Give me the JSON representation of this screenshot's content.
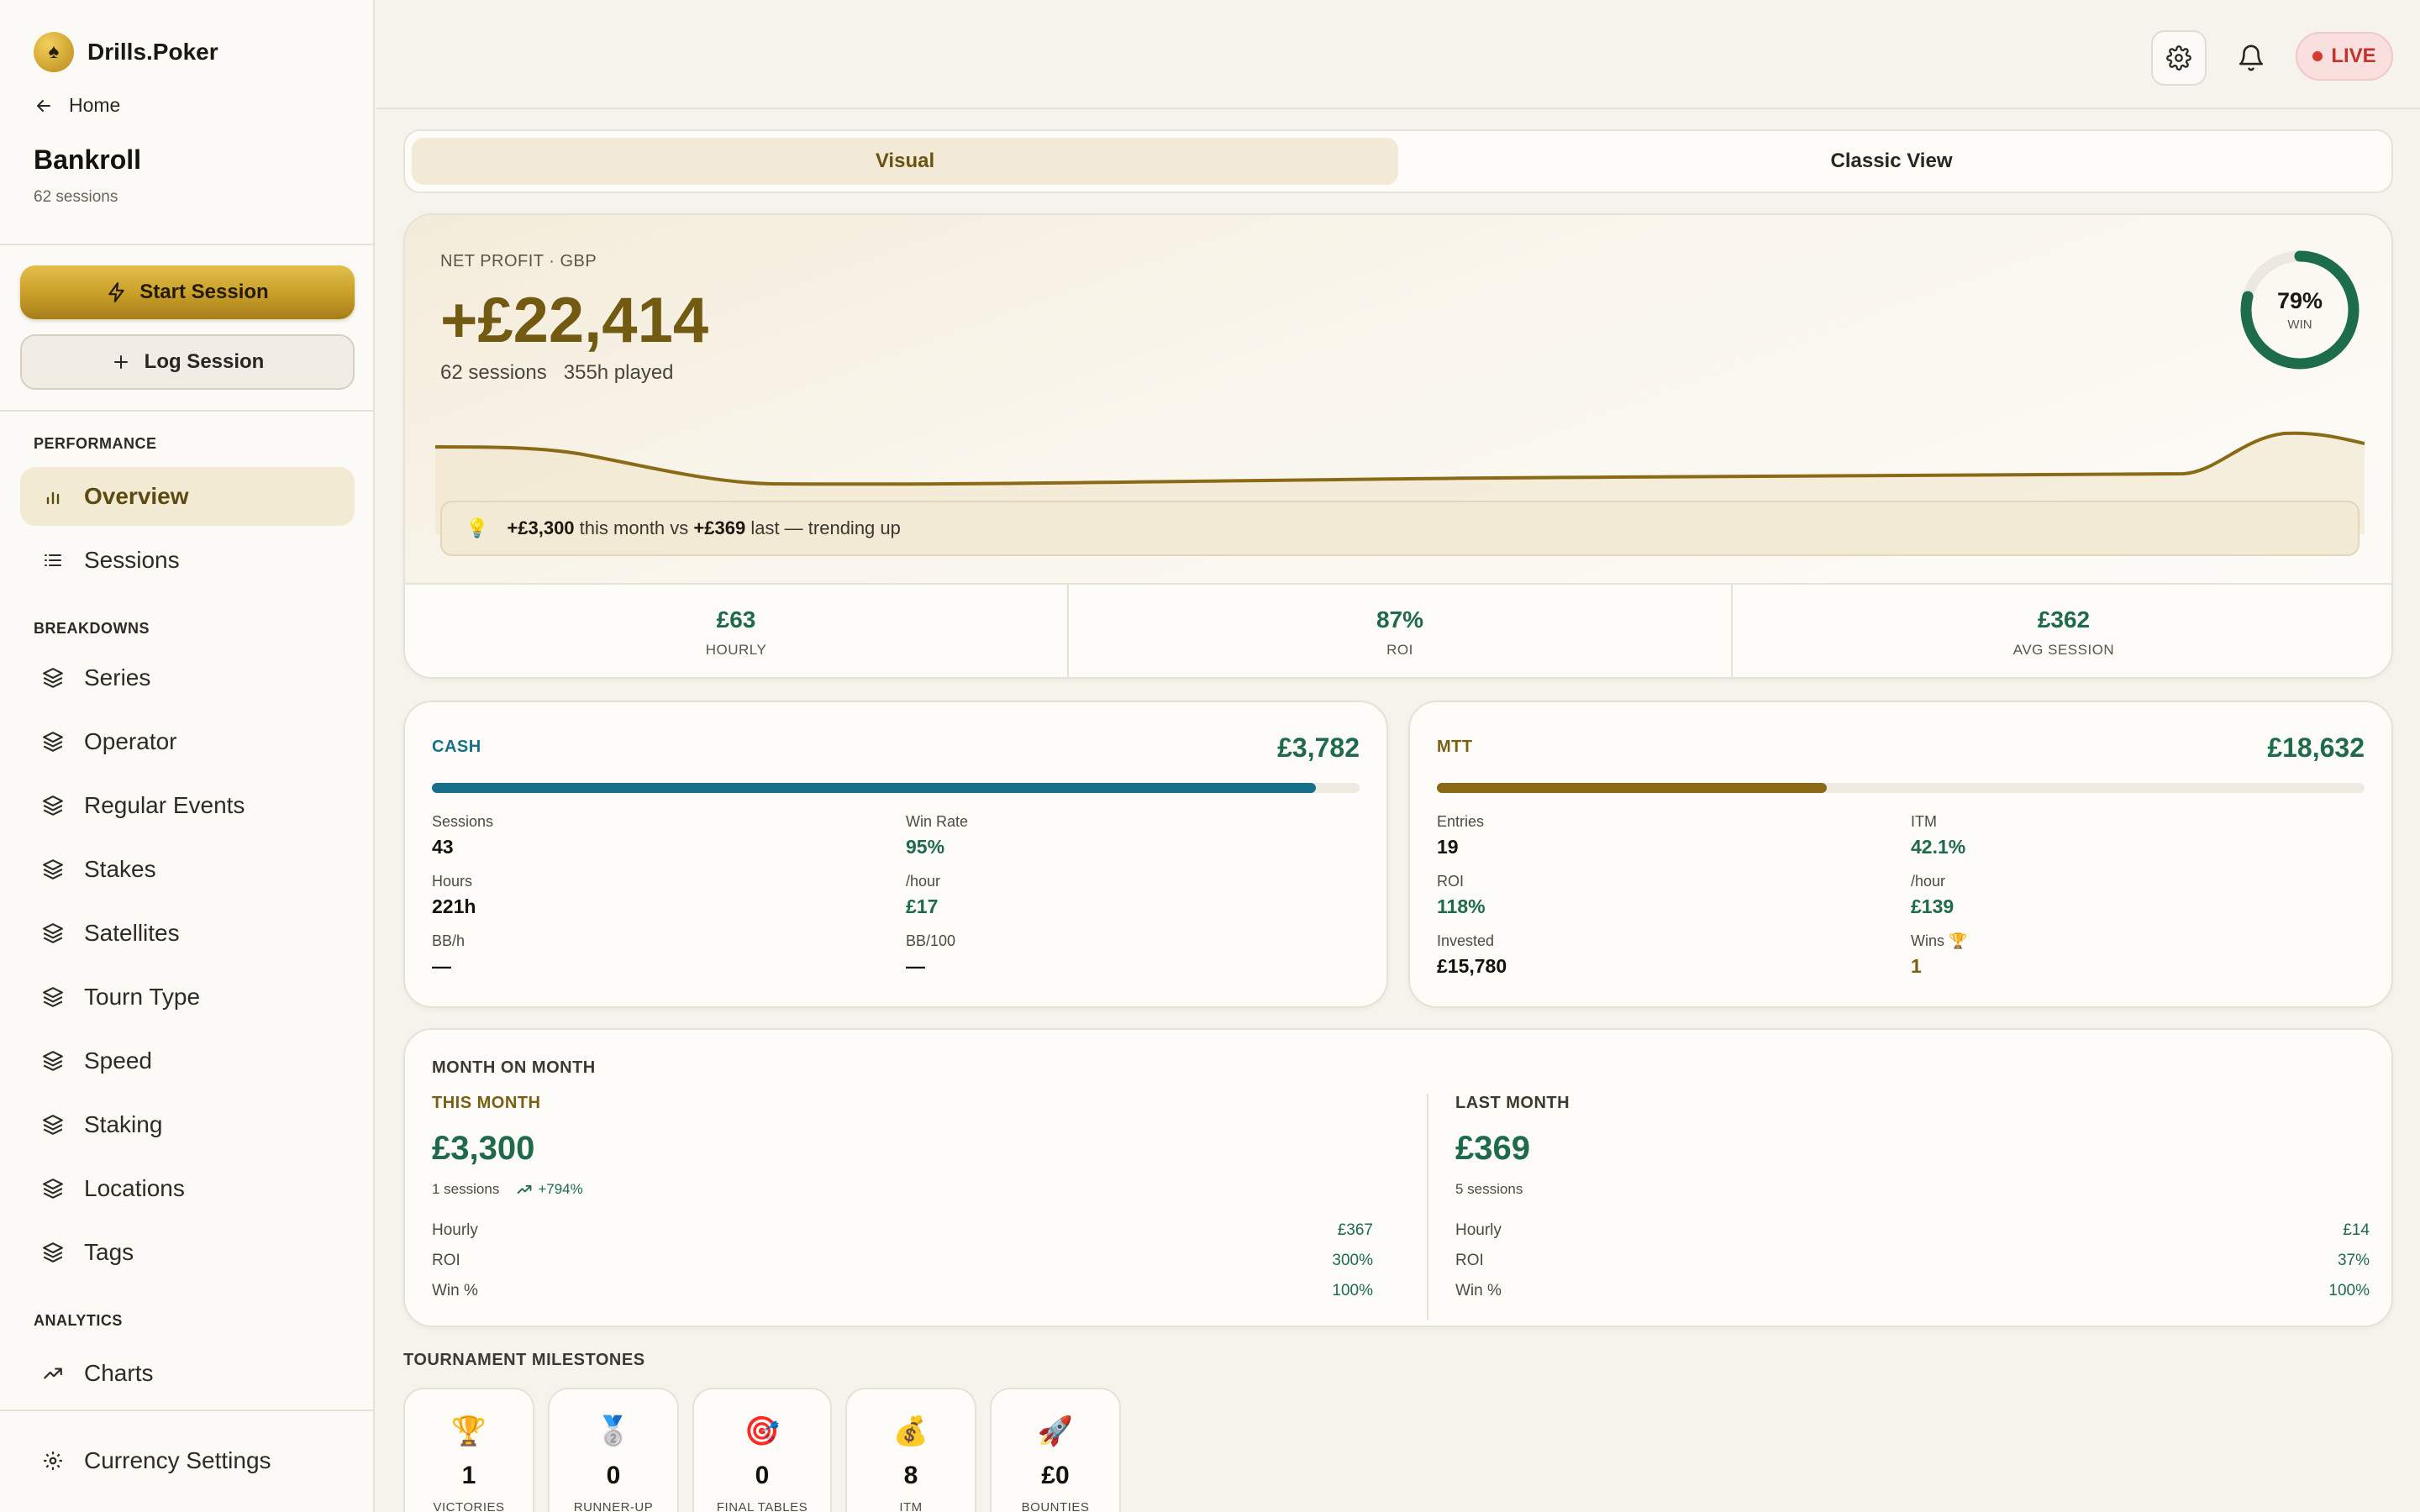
{
  "brand": {
    "name": "Drills.Poker"
  },
  "nav_back": {
    "label": "Home"
  },
  "page": {
    "title": "Bankroll",
    "subtitle": "62 sessions"
  },
  "actions": {
    "start_label": "Start Session",
    "log_label": "Log Session"
  },
  "sidebar": {
    "sections": [
      {
        "label": "PERFORMANCE"
      },
      {
        "label": "BREAKDOWNS"
      },
      {
        "label": "ANALYTICS"
      }
    ],
    "items": [
      {
        "label": "Overview",
        "icon": "bar-chart-icon",
        "active": true
      },
      {
        "label": "Sessions",
        "icon": "list-icon"
      },
      {
        "label": "Series",
        "icon": "layers-icon"
      },
      {
        "label": "Operator",
        "icon": "layers-icon"
      },
      {
        "label": "Regular Events",
        "icon": "layers-icon"
      },
      {
        "label": "Stakes",
        "icon": "layers-icon"
      },
      {
        "label": "Satellites",
        "icon": "layers-icon"
      },
      {
        "label": "Tourn Type",
        "icon": "layers-icon"
      },
      {
        "label": "Speed",
        "icon": "layers-icon"
      },
      {
        "label": "Staking",
        "icon": "layers-icon"
      },
      {
        "label": "Locations",
        "icon": "layers-icon"
      },
      {
        "label": "Tags",
        "icon": "layers-icon"
      },
      {
        "label": "Charts",
        "icon": "trending-up-icon"
      }
    ],
    "footer": {
      "label": "Currency Settings",
      "icon": "gear-icon"
    }
  },
  "topbar": {
    "live_label": "LIVE"
  },
  "tabs": [
    {
      "label": "Visual",
      "active": true
    },
    {
      "label": "Classic View",
      "active": false
    }
  ],
  "hero": {
    "label": "NET PROFIT · GBP",
    "value": "+£22,414",
    "sessions": "62 sessions",
    "played": "355h played",
    "win_rate": "79%",
    "win_label": "WIN",
    "win_fraction": 0.79,
    "insight": {
      "this_month": "+£3,300",
      "text_mid": "this month vs",
      "last_month": "+£369",
      "text_end": "last — trending up"
    },
    "stats": [
      {
        "value": "£63",
        "label": "HOURLY"
      },
      {
        "value": "87%",
        "label": "ROI"
      },
      {
        "value": "£362",
        "label": "AVG SESSION"
      }
    ]
  },
  "cash": {
    "title": "CASH",
    "total": "£3,782",
    "share": 0.953,
    "color": "#17708a",
    "stats": [
      {
        "label": "Sessions",
        "value": "43",
        "tone": "dark"
      },
      {
        "label": "Win Rate",
        "value": "95%",
        "tone": "green"
      },
      {
        "label": "Hours",
        "value": "221h",
        "tone": "dark"
      },
      {
        "label": "/hour",
        "value": "£17",
        "tone": "green"
      },
      {
        "label": "BB/h",
        "value": "—",
        "tone": "dark"
      },
      {
        "label": "BB/100",
        "value": "—",
        "tone": "dark"
      }
    ]
  },
  "mtt": {
    "title": "MTT",
    "total": "£18,632",
    "share": 0.42,
    "color": "#8a6a17",
    "stats": [
      {
        "label": "Entries",
        "value": "19",
        "tone": "dark"
      },
      {
        "label": "ITM",
        "value": "42.1%",
        "tone": "green"
      },
      {
        "label": "ROI",
        "value": "118%",
        "tone": "green"
      },
      {
        "label": "/hour",
        "value": "£139",
        "tone": "green"
      },
      {
        "label": "Invested",
        "value": "£15,780",
        "tone": "dark"
      },
      {
        "label": "Wins 🏆",
        "value": "1",
        "tone": "gold"
      }
    ]
  },
  "mom": {
    "title": "MONTH ON MONTH",
    "this_month": {
      "label": "THIS MONTH",
      "value": "£3,300",
      "sessions": "1 sessions",
      "trend": "+794%",
      "rows": [
        {
          "label": "Hourly",
          "value": "£367"
        },
        {
          "label": "ROI",
          "value": "300%"
        },
        {
          "label": "Win %",
          "value": "100%"
        }
      ]
    },
    "last_month": {
      "label": "LAST MONTH",
      "value": "£369",
      "sessions": "5 sessions",
      "rows": [
        {
          "label": "Hourly",
          "value": "£14"
        },
        {
          "label": "ROI",
          "value": "37%"
        },
        {
          "label": "Win %",
          "value": "100%"
        }
      ]
    }
  },
  "milestones": {
    "title": "TOURNAMENT MILESTONES",
    "items": [
      {
        "icon": "🏆",
        "value": "1",
        "label": "VICTORIES"
      },
      {
        "icon": "🥈",
        "value": "0",
        "label": "RUNNER-UP"
      },
      {
        "icon": "🎯",
        "value": "0",
        "label": "FINAL TABLES"
      },
      {
        "icon": "💰",
        "value": "8",
        "label": "ITM"
      },
      {
        "icon": "🚀",
        "value": "£0",
        "label": "BOUNTIES"
      }
    ]
  }
}
